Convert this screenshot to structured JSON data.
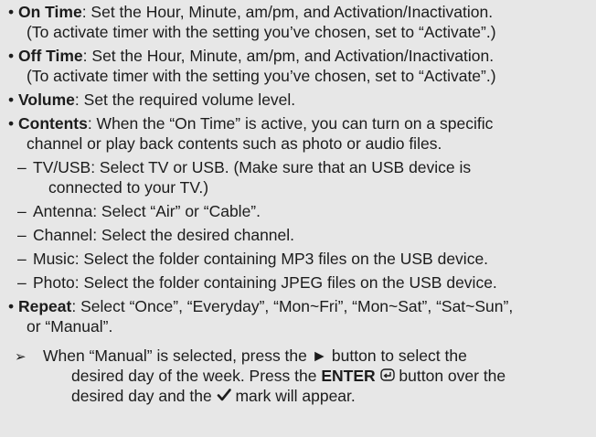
{
  "bullets": {
    "on_time": {
      "label": "On Time",
      "line1": ": Set the Hour, Minute, am/pm, and Activation/Inactivation.",
      "line2": "(To activate timer with the setting you’ve chosen, set to “Activate”.)"
    },
    "off_time": {
      "label": "Off Time",
      "line1": ": Set the Hour, Minute, am/pm, and Activation/Inactivation.",
      "line2": "(To activate timer with the setting you’ve chosen, set to “Activate”.)"
    },
    "volume": {
      "label": "Volume",
      "line1": ": Set the required volume level."
    },
    "contents": {
      "label": "Contents",
      "line1": ": When the “On Time” is active, you can turn on a specific",
      "line2": "channel or play back contents such as photo or audio files.",
      "subitems": [
        {
          "line1": "TV/USB: Select TV or USB. (Make sure that an USB device is",
          "line2": "connected to your TV.)"
        },
        {
          "line1": "Antenna: Select “Air” or “Cable”."
        },
        {
          "line1": "Channel: Select the desired channel."
        },
        {
          "line1": "Music: Select the folder containing MP3 files on the USB device."
        },
        {
          "line1": "Photo: Select the folder containing JPEG files on the USB device."
        }
      ]
    },
    "repeat": {
      "label": "Repeat",
      "line1": ": Select “Once”, “Everyday”, “Mon~Fri”, “Mon~Sat”, “Sat~Sun”,",
      "line2": "or “Manual”.",
      "note": {
        "line1": "When “Manual” is selected, press the ► button to select the",
        "line2a": "desired day of the week. Press the ",
        "line2b": "ENTER",
        "line2c": " button over the",
        "line3a": "desired day and the ",
        "line3b": " mark will appear."
      }
    }
  },
  "markers": {
    "bullet": "•",
    "dash": "–",
    "arrow": "➢"
  },
  "icons": [
    "enter-icon",
    "check-mark-icon"
  ],
  "colors": {
    "background": "#e7e7e7",
    "text": "#1c1c1c"
  }
}
